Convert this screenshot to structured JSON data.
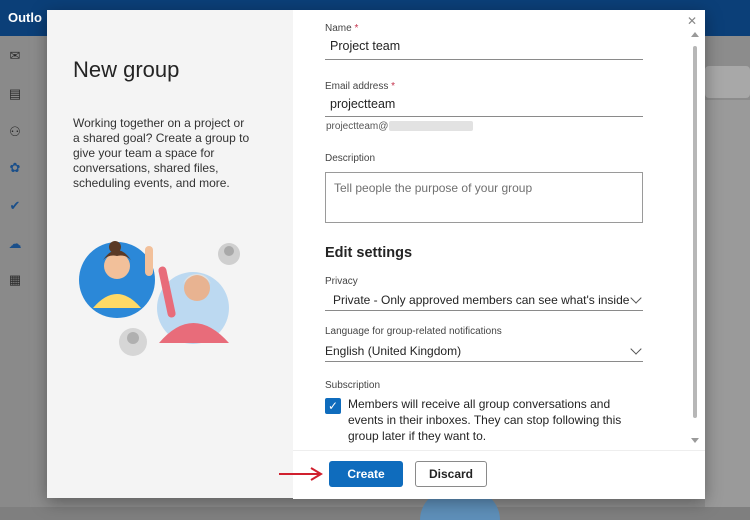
{
  "app": {
    "title": "Outlo"
  },
  "rail_icons": [
    "mail-icon",
    "calendar-icon",
    "people-icon",
    "groups-icon",
    "todo-icon",
    "cloud-icon",
    "apps-icon"
  ],
  "modal": {
    "title": "New group",
    "description": "Working together on a project or a shared goal? Create a group to give your team a space for conversations, shared files, scheduling events, and more.",
    "close_icon": "close-icon"
  },
  "form": {
    "name": {
      "label": "Name",
      "required_mark": "*",
      "value": "Project team"
    },
    "email": {
      "label": "Email address",
      "required_mark": "*",
      "value": "projectteam",
      "hint_prefix": "projectteam@"
    },
    "description": {
      "label": "Description",
      "placeholder": "Tell people the purpose of your group"
    },
    "edit_settings": "Edit settings",
    "privacy": {
      "label": "Privacy",
      "value": "Private - Only approved members can see what's inside"
    },
    "language": {
      "label": "Language for group-related notifications",
      "value": "English (United Kingdom)"
    },
    "subscription": {
      "label": "Subscription",
      "checked": true,
      "text": "Members will receive all group conversations and events in their inboxes. They can stop following this group later if they want to."
    }
  },
  "buttons": {
    "create": "Create",
    "discard": "Discard"
  },
  "colors": {
    "accent": "#0f6cbd",
    "arrow": "#d0202e",
    "topbar": "#0b3f78"
  }
}
